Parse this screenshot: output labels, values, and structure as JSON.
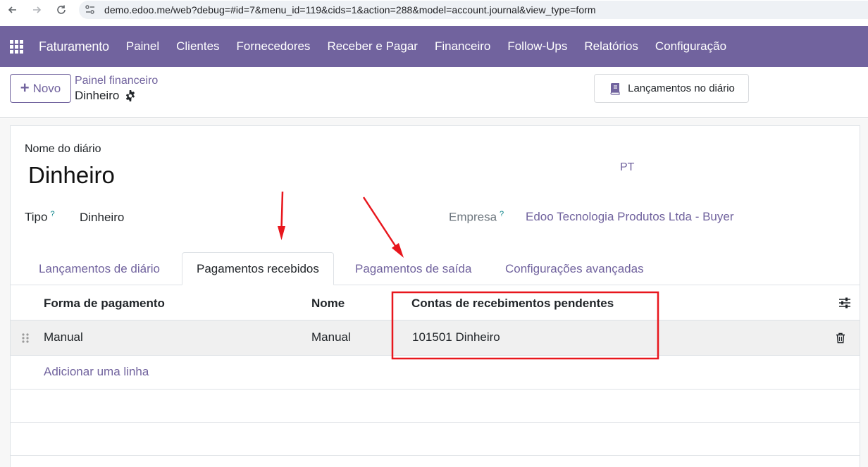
{
  "browser": {
    "url": "demo.edoo.me/web?debug=#id=7&menu_id=119&cids=1&action=288&model=account.journal&view_type=form"
  },
  "topnav": {
    "brand": "Faturamento",
    "menu": [
      "Painel",
      "Clientes",
      "Fornecedores",
      "Receber e Pagar",
      "Financeiro",
      "Follow-Ups",
      "Relatórios",
      "Configuração"
    ],
    "color": "#71639e"
  },
  "control": {
    "new_label": "Novo",
    "breadcrumb_parent": "Painel financeiro",
    "breadcrumb_current": "Dinheiro",
    "journal_entries_button": "Lançamentos no diário"
  },
  "form": {
    "name_label": "Nome do diário",
    "name_value": "Dinheiro",
    "language": "PT",
    "type_label": "Tipo",
    "type_help": "?",
    "type_value": "Dinheiro",
    "company_label": "Empresa",
    "company_help": "?",
    "company_value": "Edoo Tecnologia Produtos Ltda - Buyer"
  },
  "tabs": [
    {
      "label": "Lançamentos de diário",
      "active": false
    },
    {
      "label": "Pagamentos recebidos",
      "active": true
    },
    {
      "label": "Pagamentos de saída",
      "active": false
    },
    {
      "label": "Configurações avançadas",
      "active": false
    }
  ],
  "table": {
    "columns": [
      "Forma de pagamento",
      "Nome",
      "Contas de recebimentos pendentes"
    ],
    "rows": [
      [
        "Manual",
        "Manual",
        "101501 Dinheiro"
      ]
    ],
    "add_line": "Adicionar uma linha"
  },
  "annotation_color": "#e8161d"
}
